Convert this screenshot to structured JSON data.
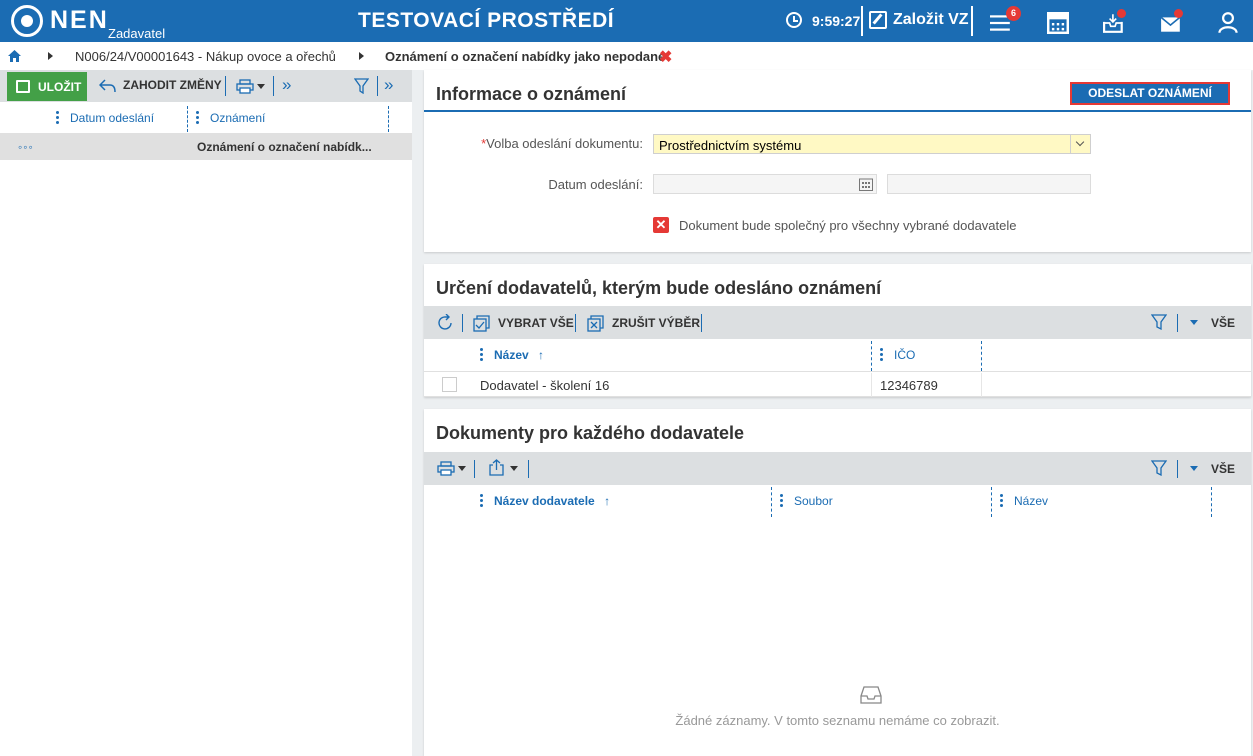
{
  "topbar": {
    "logo": "NEN",
    "logo_sub": "Zadavatel",
    "env_title": "TESTOVACÍ PROSTŘEDÍ",
    "time": "9:59:27",
    "create_label": "Založit VZ",
    "menu_badge": "6",
    "icons": [
      "clock-icon",
      "edit-icon",
      "menu-icon",
      "calculator-icon",
      "inbox-icon",
      "mail-icon",
      "user-icon"
    ],
    "accent_color": "#1b6cb3",
    "badge_color": "#e53935"
  },
  "breadcrumb": {
    "item1": "N006/24/V00001643 - Nákup ovoce a ořechů",
    "current": "Oznámení o označení nabídky jako nepodané",
    "close": "✖"
  },
  "left": {
    "save_label": "ULOŽIT",
    "discard_label": "ZAHODIT ZMĚNY",
    "col_date": "Datum odeslání",
    "col_notice": "Oznámení",
    "row_more": "◦◦◦",
    "row_notice": "Oznámení o označení nabídk..."
  },
  "info": {
    "title": "Informace o oznámení",
    "send_button": "ODESLAT OZNÁMENÍ",
    "req_mark": "*",
    "volba_label": "Volba odeslání dokumentu:",
    "volba_value": "Prostřednictvím systému",
    "datum_label": "Datum odeslání:",
    "datum_value": "",
    "checkbox_mark": "✕",
    "checkbox_label": "Dokument bude společný pro všechny vybrané dodavatele"
  },
  "suppliers": {
    "title": "Určení dodavatelů, kterým bude odesláno oznámení",
    "select_all": "VYBRAT VŠE",
    "deselect": "ZRUŠIT VÝBĚR",
    "vse": "VŠE",
    "col_name": "Název",
    "col_ico": "IČO",
    "sort_arrow": "↑",
    "rows": [
      {
        "name": "Dodavatel - školení 16",
        "ico": "12346789"
      }
    ]
  },
  "documents": {
    "title": "Dokumenty pro každého dodavatele",
    "vse": "VŠE",
    "col_supplier": "Název dodavatele",
    "col_file": "Soubor",
    "col_name": "Název",
    "sort_arrow": "↑",
    "empty_text": "Žádné záznamy. V tomto seznamu nemáme co zobrazit."
  }
}
